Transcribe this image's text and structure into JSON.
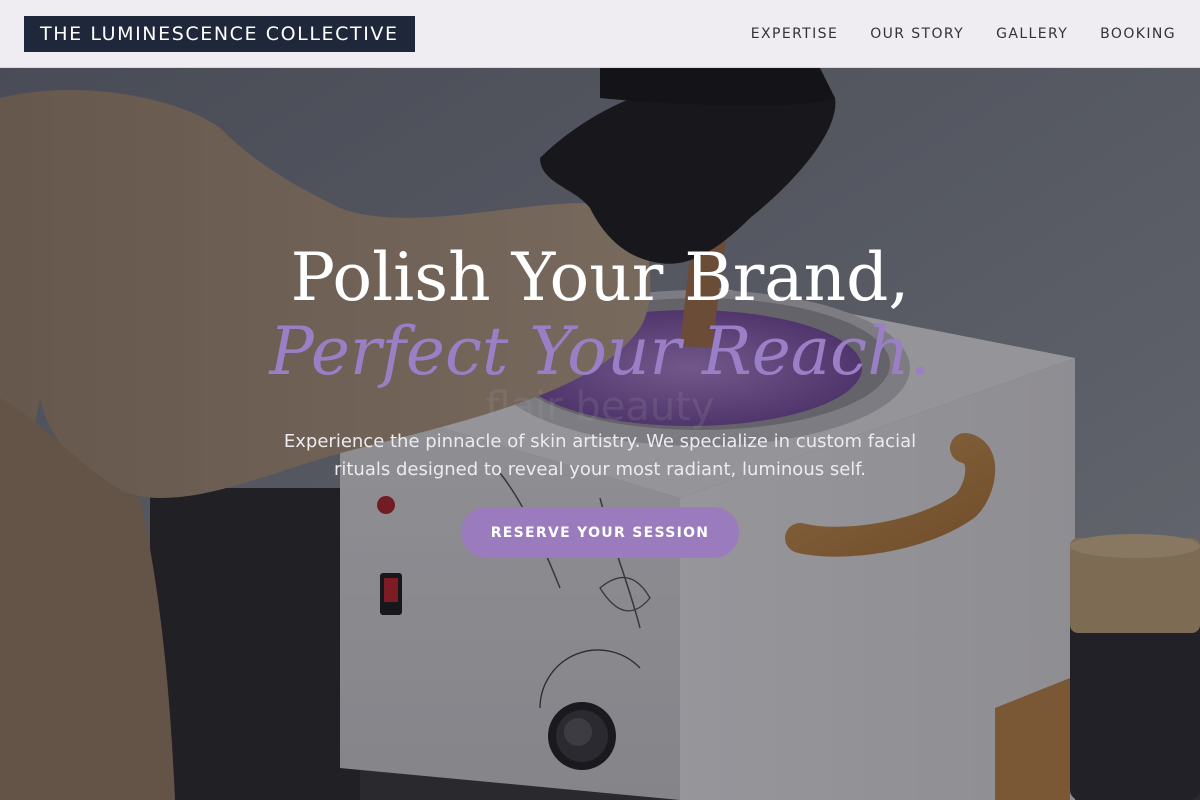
{
  "brand": {
    "logo_text": "THE LUMINESCENCE COLLECTIVE"
  },
  "nav": {
    "items": [
      {
        "label": "EXPERTISE"
      },
      {
        "label": "OUR STORY"
      },
      {
        "label": "GALLERY"
      },
      {
        "label": "BOOKING"
      }
    ]
  },
  "hero": {
    "headline_line1": "Polish Your Brand,",
    "headline_line2": "Perfect Your Reach.",
    "subtitle": "Experience the pinnacle of skin artistry. We specialize in custom facial rituals designed to reveal your most radiant, luminous self.",
    "cta_label": "RESERVE YOUR SESSION",
    "background_image": "wax-warmer-photo",
    "watermark_text": "flair beauty"
  },
  "colors": {
    "header_bg": "#efedf1",
    "logo_bg": "#1f283b",
    "accent_lavender": "#9b7fc6",
    "cta_bg": "#9a7bbd"
  }
}
